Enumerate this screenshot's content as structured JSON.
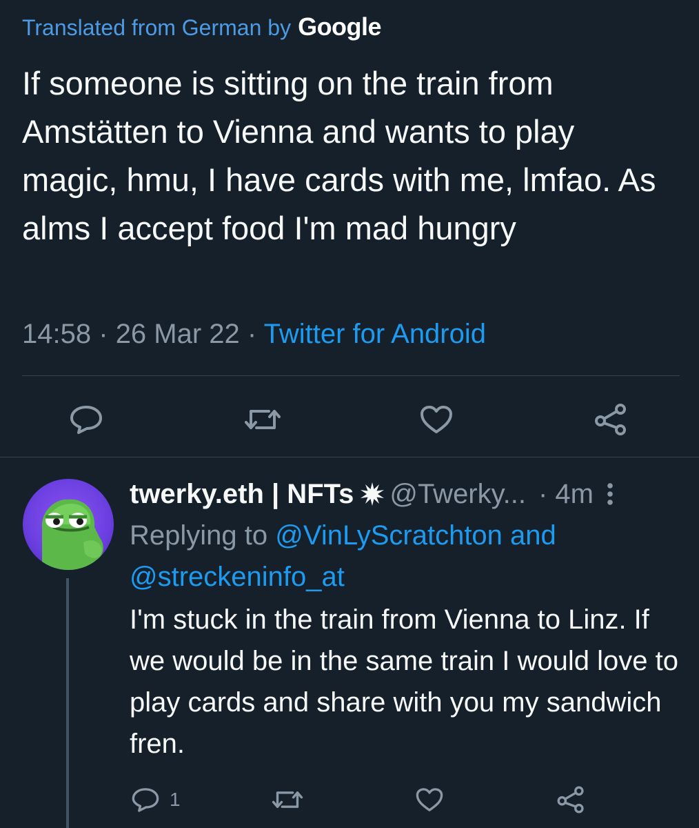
{
  "translation": {
    "prefix": "Translated from German by",
    "provider": "Google"
  },
  "tweet": {
    "text": "If someone is sitting on the train from Amstätten to Vienna and wants to play magic, hmu, I have cards with me, lmfao. As alms I accept food I'm mad hungry",
    "time": "14:58",
    "date": "26 Mar 22",
    "source": "Twitter for Android",
    "separator": "·"
  },
  "tweet_actions": {
    "reply_icon": "reply-icon",
    "retweet_icon": "retweet-icon",
    "like_icon": "heart-icon",
    "share_icon": "share-icon"
  },
  "reply": {
    "display_name": "twerky.eth | NFTs",
    "badge_icon": "burst-icon",
    "handle": "@Twerky...",
    "time": "· 4m",
    "replying_label": "Replying to",
    "mention_1": "@VinLyScratchton",
    "and_word": "and",
    "mention_2": "@streckeninfo_at",
    "text": "I'm stuck in the train from Vienna to Linz. If we would be in the same train I would love to play cards and share with you my sandwich fren.",
    "reply_count": "1"
  },
  "colors": {
    "background": "#15202b",
    "text": "#f7f9f9",
    "muted": "#8b98a5",
    "accent": "#1d9bf0",
    "divider": "#38444d"
  }
}
